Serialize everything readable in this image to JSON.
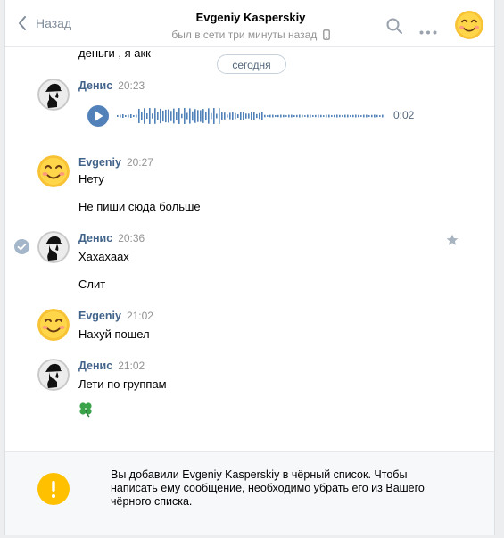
{
  "header": {
    "back_label": "Назад",
    "title": "Evgeniy Kasperskiy",
    "subtitle": "был в сети три минуты назад"
  },
  "chat": {
    "cut_text": "деньги , я акк",
    "date_label": "сегодня",
    "voice_duration": "0:02",
    "messages": [
      {
        "name": "Денис",
        "time": "20:23"
      },
      {
        "name": "Evgeniy",
        "time": "20:27",
        "lines": [
          "Нету",
          "Не пиши сюда больше"
        ]
      },
      {
        "name": "Денис",
        "time": "20:36",
        "lines": [
          "Хахахаах",
          "Слит"
        ]
      },
      {
        "name": "Evgeniy",
        "time": "21:02",
        "lines": [
          "Нахуй пошел"
        ]
      },
      {
        "name": "Денис",
        "time": "21:02",
        "lines": [
          "Лети по группам"
        ]
      }
    ]
  },
  "footer": {
    "notice": "Вы добавили Evgeniy Kasperskiy в чёрный список. Чтобы написать ему сообщение, необходимо убрать его из Вашего чёрного списка."
  },
  "colors": {
    "accent": "#5181b8",
    "name": "#42648b",
    "warning": "#ffc000"
  }
}
